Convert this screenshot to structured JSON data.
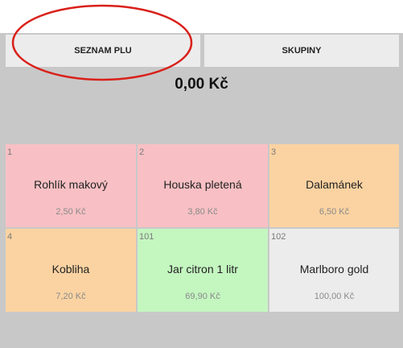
{
  "tabs": {
    "plu_label": "SEZNAM PLU",
    "groups_label": "SKUPINY"
  },
  "total": "0,00 Kč",
  "colors": {
    "pink": "#f8c0c4",
    "orange": "#fbd3a2",
    "green": "#c4f6c0",
    "gray": "#ececec",
    "highlight": "#d9201a"
  },
  "products": [
    {
      "code": "1",
      "name": "Rohlík makový",
      "price": "2,50 Kč",
      "color": "#f8c0c4"
    },
    {
      "code": "2",
      "name": "Houska pletená",
      "price": "3,80 Kč",
      "color": "#f8c0c4"
    },
    {
      "code": "3",
      "name": "Dalamánek",
      "price": "6,50 Kč",
      "color": "#fbd3a2"
    },
    {
      "code": "4",
      "name": "Kobliha",
      "price": "7,20 Kč",
      "color": "#fbd3a2"
    },
    {
      "code": "101",
      "name": "Jar citron 1 litr",
      "price": "69,90 Kč",
      "color": "#c4f6c0"
    },
    {
      "code": "102",
      "name": "Marlboro gold",
      "price": "100,00 Kč",
      "color": "#ececec"
    }
  ]
}
